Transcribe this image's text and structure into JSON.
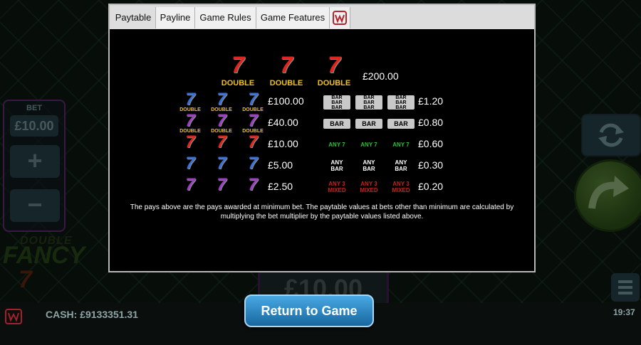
{
  "bet": {
    "label": "BET",
    "value": "£10.00",
    "plus": "+",
    "minus": "−"
  },
  "logo": {
    "line1": "DOUBLE",
    "line2": "FANCY",
    "line3": "7"
  },
  "bottom_bet": "£10.00",
  "footer": {
    "cash": "CASH: £9133351.31",
    "time": "19:37"
  },
  "return_button": "Return to Game",
  "tabs": [
    "Paytable",
    "Payline",
    "Game Rules",
    "Game Features"
  ],
  "paytable": {
    "top": {
      "symbol_label": "DOUBLE",
      "pay": "£200.00"
    },
    "left_rows": [
      {
        "symbol": "blue-double-7",
        "pay": "£100.00"
      },
      {
        "symbol": "purple-double-7",
        "pay": "£40.00"
      },
      {
        "symbol": "red-7",
        "pay": "£10.00"
      },
      {
        "symbol": "blue-7",
        "pay": "£5.00"
      },
      {
        "symbol": "purple-7",
        "pay": "£2.50"
      }
    ],
    "right_rows": [
      {
        "labels": [
          "BAR\nBAR\nBAR",
          "BAR\nBAR\nBAR",
          "BAR\nBAR\nBAR"
        ],
        "pay": "£1.20"
      },
      {
        "labels": [
          "BAR",
          "BAR",
          "BAR"
        ],
        "pay": "£0.80"
      },
      {
        "labels": [
          "ANY 7",
          "ANY 7",
          "ANY 7"
        ],
        "pay": "£0.60"
      },
      {
        "labels": [
          "ANY\nBAR",
          "ANY\nBAR",
          "ANY\nBAR"
        ],
        "pay": "£0.30"
      },
      {
        "labels": [
          "ANY 3\nMIXED",
          "ANY 3\nMIXED",
          "ANY 3\nMIXED"
        ],
        "pay": "£0.20"
      }
    ],
    "double_label": "DOUBLE",
    "note": "The pays above are the pays awarded at minimum bet. The paytable values at bets other than minimum are calculated by multiplying the bet multiplier by the paytable values listed above."
  },
  "colors": {
    "red7": "#e0261c",
    "blue7": "#3b6fd8",
    "purple7": "#9a3fc2",
    "gold": "#f3c20f",
    "any7": "#2fbf3a",
    "mixed": "#c8231b"
  }
}
